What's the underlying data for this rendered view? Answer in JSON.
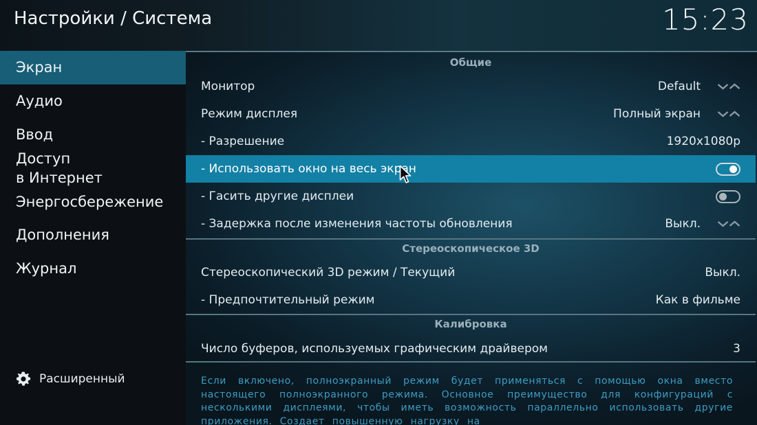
{
  "header": {
    "title": "Настройки / Система",
    "clock": "15:23"
  },
  "sidebar": {
    "items": [
      {
        "label": "Экран"
      },
      {
        "label": "Аудио"
      },
      {
        "label": "Ввод"
      },
      {
        "label": "Доступ"
      },
      {
        "label": "в Интернет"
      },
      {
        "label": "Энергосбережение"
      },
      {
        "label": "Дополнения"
      },
      {
        "label": "Журнал"
      }
    ],
    "advanced_label": "Расширенный"
  },
  "sections": {
    "general": "Общие",
    "stereo": "Стереоскопическое 3D",
    "calibration": "Калибровка"
  },
  "settings": {
    "monitor": {
      "label": "Монитор",
      "value": "Default"
    },
    "display_mode": {
      "label": "Режим дисплея",
      "value": "Полный экран"
    },
    "resolution": {
      "label": "- Разрешение",
      "value": "1920x1080p"
    },
    "fullscreen_window": {
      "label": "- Использовать окно на весь экран",
      "state": "on"
    },
    "blank_displays": {
      "label": "- Гасить другие дисплеи",
      "state": "off"
    },
    "refresh_delay": {
      "label": "- Задержка после изменения частоты обновления",
      "value": "Выкл."
    },
    "stereo_mode": {
      "label": "Стереоскопический 3D режим / Текущий",
      "value": "Выкл."
    },
    "preferred_mode": {
      "label": "- Предпочтительный режим",
      "value": "Как в фильме"
    },
    "buffers": {
      "label": "Число буферов, используемых графическим драйвером",
      "value": "3"
    }
  },
  "description": "Если включено, полноэкранный режим будет применяться с помощью окна вместо настоящего полноэкранного режима. Основное преимущество для конфигураций с несколькими дисплеями, чтобы иметь возможность параллельно использовать другие приложения. Создает повышенную нагрузку на",
  "colors": {
    "highlight": "#1380a5",
    "sidebar_active": "#175e76",
    "description_text": "#3e9cc3"
  }
}
